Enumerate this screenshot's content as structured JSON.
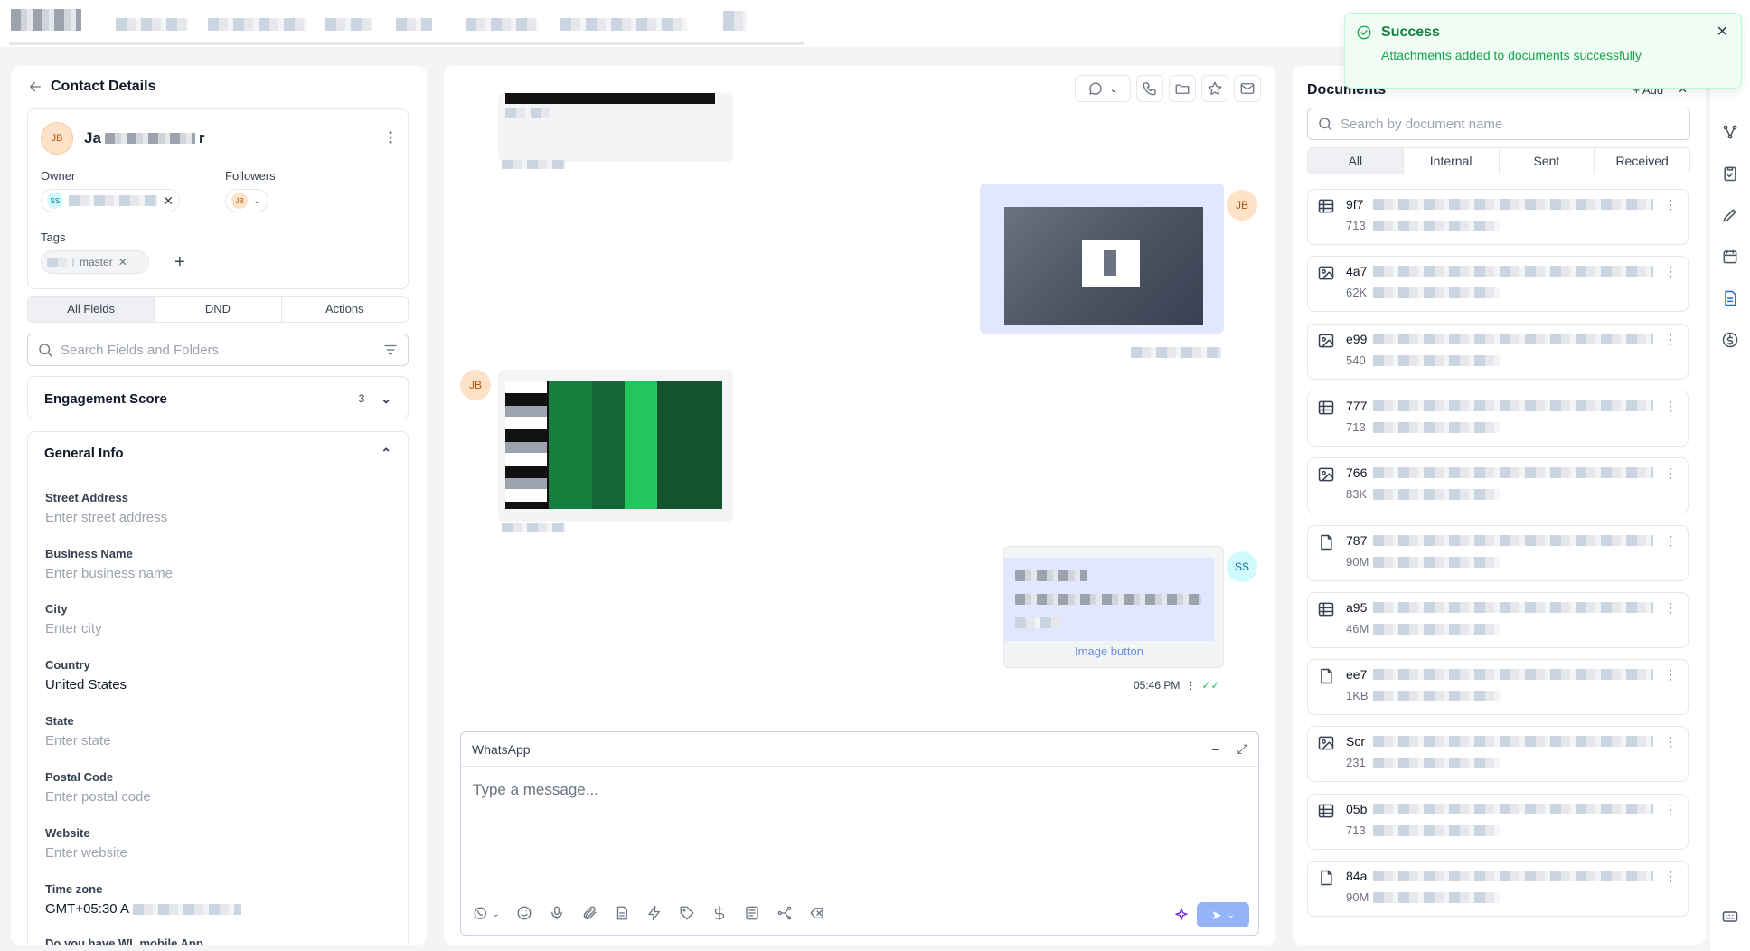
{
  "toast": {
    "title": "Success",
    "message": "Attachments added to documents successfully"
  },
  "contact": {
    "header": "Contact Details",
    "avatar_initials": "JB",
    "name_visible": "Ja",
    "name_tail": "r",
    "owner_label": "Owner",
    "owner_initials": "SS",
    "followers_label": "Followers",
    "follower_initials": "JB",
    "tags_label": "Tags",
    "tag_visible": "master",
    "tabs": [
      "All Fields",
      "DND",
      "Actions"
    ],
    "search_placeholder": "Search Fields and Folders",
    "engagement": {
      "label": "Engagement Score",
      "value": "3"
    },
    "general_info": "General Info",
    "fields": [
      {
        "label": "Street Address",
        "placeholder": "Enter street address"
      },
      {
        "label": "Business Name",
        "placeholder": "Enter business name"
      },
      {
        "label": "City",
        "placeholder": "Enter city"
      },
      {
        "label": "Country",
        "value": "United States"
      },
      {
        "label": "State",
        "placeholder": "Enter state"
      },
      {
        "label": "Postal Code",
        "placeholder": "Enter postal code"
      },
      {
        "label": "Website",
        "placeholder": "Enter website"
      },
      {
        "label": "Time zone",
        "value": "GMT+05:30 A"
      }
    ],
    "cut_field": "Do you have WL mobile App"
  },
  "conversation": {
    "msg_avatar_jb": "JB",
    "msg_avatar_ss": "SS",
    "image_button": "Image button",
    "timestamp": "05:46 PM",
    "composer_channel": "WhatsApp",
    "composer_placeholder": "Type a message..."
  },
  "documents": {
    "title": "Documents",
    "add_label": "Add",
    "search_placeholder": "Search by document name",
    "tabs": [
      "All",
      "Internal",
      "Sent",
      "Received"
    ],
    "items": [
      {
        "icon": "table-icon",
        "name": "9f7",
        "size": "713"
      },
      {
        "icon": "image-icon",
        "name": "4a7",
        "size": "62K"
      },
      {
        "icon": "image-icon",
        "name": "e99",
        "size": "540"
      },
      {
        "icon": "table-icon",
        "name": "777",
        "size": "713"
      },
      {
        "icon": "image-icon",
        "name": "766",
        "size": "83K"
      },
      {
        "icon": "file-icon",
        "name": "787",
        "size": "90M"
      },
      {
        "icon": "table-icon",
        "name": "a95",
        "size": "46M"
      },
      {
        "icon": "file-icon",
        "name": "ee7",
        "size": "1KB"
      },
      {
        "icon": "image-icon",
        "name": "Scr",
        "size": "231"
      },
      {
        "icon": "table-icon",
        "name": "05b",
        "size": "713"
      },
      {
        "icon": "file-icon",
        "name": "84a",
        "size": "90M"
      }
    ]
  },
  "colors": {
    "accent": "#3b82f6",
    "success": "#16a34a",
    "whatsapp": "#25d366"
  }
}
